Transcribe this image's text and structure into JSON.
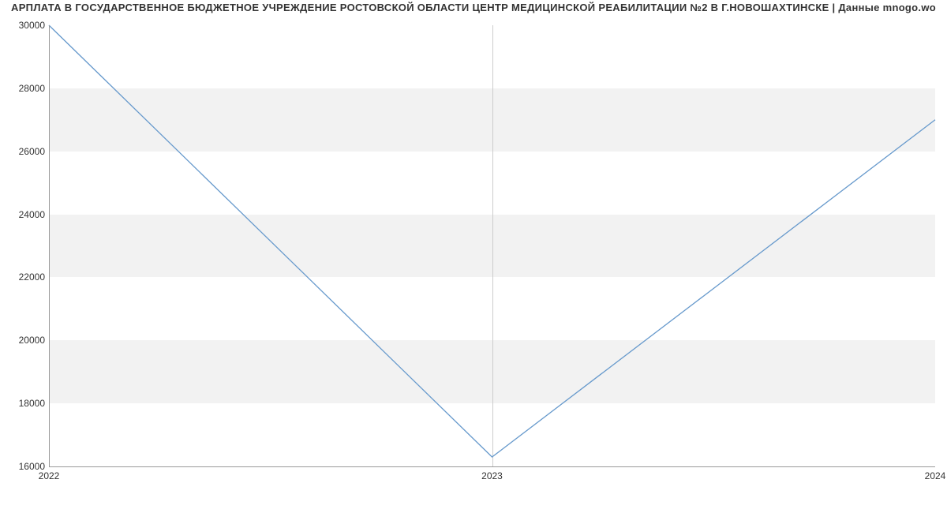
{
  "chart_data": {
    "type": "line",
    "title": "АРПЛАТА В ГОСУДАРСТВЕННОЕ БЮДЖЕТНОЕ УЧРЕЖДЕНИЕ РОСТОВСКОЙ ОБЛАСТИ ЦЕНТР МЕДИЦИНСКОЙ РЕАБИЛИТАЦИИ №2 В  Г.НОВОШАХТИНСКЕ | Данные mnogo.wo",
    "x": [
      "2022",
      "2023",
      "2024"
    ],
    "values": [
      30000,
      16300,
      27000
    ],
    "xlabel": "",
    "ylabel": "",
    "ylim": [
      16000,
      30000
    ],
    "y_ticks": [
      16000,
      18000,
      20000,
      22000,
      24000,
      26000,
      28000,
      30000
    ],
    "x_ticks": [
      "2022",
      "2023",
      "2024"
    ]
  }
}
